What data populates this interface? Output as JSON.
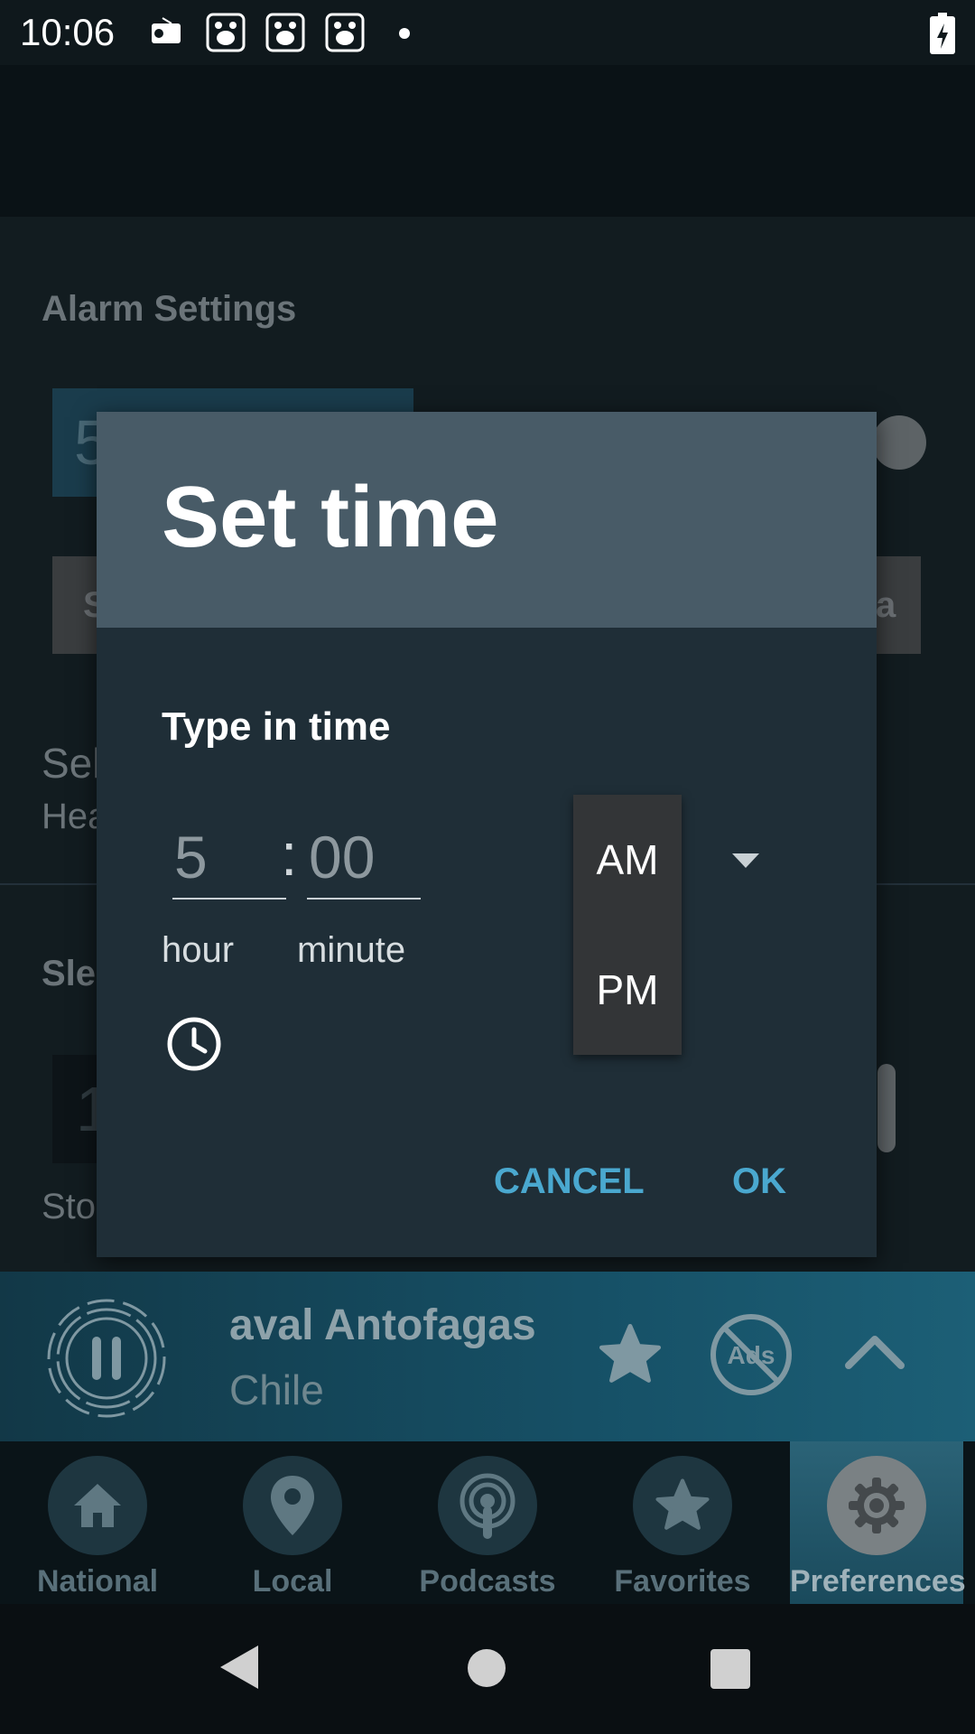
{
  "status_bar": {
    "time": "10:06"
  },
  "background": {
    "section_alarm": "Alarm Settings",
    "alarm_time_partial": "5",
    "select_partial": "Sel",
    "head_partial": "Hea",
    "sleep_partial": "Sle",
    "timer_partial": "1",
    "stop_partial": "Sto",
    "button_partial_left": "S",
    "button_partial_right": "a"
  },
  "dialog": {
    "title": "Set time",
    "input_label": "Type in time",
    "hour_value": "5",
    "minute_value": "00",
    "hour_label": "hour",
    "minute_label": "minute",
    "ampm_options": [
      "AM",
      "PM"
    ],
    "cancel_label": "CANCEL",
    "ok_label": "OK"
  },
  "now_playing": {
    "station": "aval Antofagas",
    "country": "Chile"
  },
  "bottom_nav": [
    {
      "label": "National",
      "icon": "home-icon"
    },
    {
      "label": "Local",
      "icon": "location-pin-icon"
    },
    {
      "label": "Podcasts",
      "icon": "podcast-icon"
    },
    {
      "label": "Favorites",
      "icon": "star-icon"
    },
    {
      "label": "Preferences",
      "icon": "gear-icon",
      "active": true
    }
  ],
  "colors": {
    "accent": "#4aa8cf",
    "dialog_header": "#485b67",
    "dialog_body": "#1f2e37"
  }
}
